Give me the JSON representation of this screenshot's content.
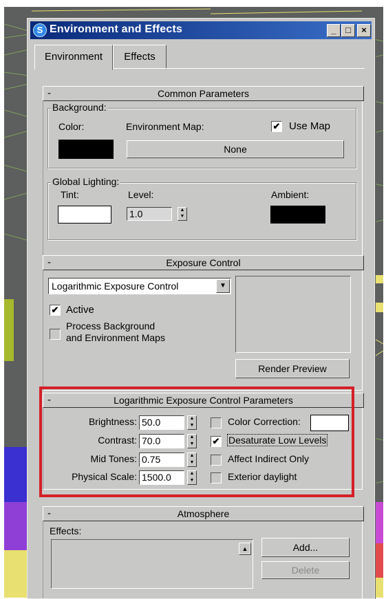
{
  "window": {
    "title": "Environment and Effects",
    "app_icon": "3ds-max-logo-icon",
    "buttons": {
      "minimize": "_",
      "maximize": "□",
      "close": "×"
    }
  },
  "tabs": [
    {
      "label": "Environment",
      "active": true
    },
    {
      "label": "Effects",
      "active": false
    }
  ],
  "common_parameters": {
    "title": "Common Parameters",
    "collapse": "-",
    "background": {
      "group_label": "Background:",
      "color_label": "Color:",
      "color_value": "#000000",
      "env_map_label": "Environment Map:",
      "use_map_label": "Use Map",
      "use_map_checked": true,
      "env_map_button": "None"
    },
    "global_lighting": {
      "group_label": "Global Lighting:",
      "tint_label": "Tint:",
      "tint_value": "#ffffff",
      "level_label": "Level:",
      "level_value": "1.0",
      "ambient_label": "Ambient:",
      "ambient_value": "#000000"
    }
  },
  "exposure_control": {
    "title": "Exposure Control",
    "collapse": "-",
    "selected": "Logarithmic Exposure Control",
    "active_label": "Active",
    "active_checked": true,
    "process_bg_label_1": "Process Background",
    "process_bg_label_2": "and Environment Maps",
    "process_bg_checked": false,
    "render_preview": "Render Preview"
  },
  "log_params": {
    "title": "Logarithmic Exposure Control Parameters",
    "collapse": "-",
    "brightness_label": "Brightness:",
    "brightness_value": "50.0",
    "contrast_label": "Contrast:",
    "contrast_value": "70.0",
    "midtones_label": "Mid Tones:",
    "midtones_value": "0.75",
    "physical_scale_label": "Physical Scale:",
    "physical_scale_value": "1500.0",
    "color_correction_label": "Color Correction:",
    "color_correction_checked": false,
    "color_correction_swatch": "#ffffff",
    "desaturate_label": "Desaturate Low Levels",
    "desaturate_checked": true,
    "affect_indirect_label": "Affect Indirect Only",
    "affect_indirect_checked": false,
    "exterior_daylight_label": "Exterior daylight",
    "exterior_daylight_checked": false,
    "highlight_color": "#d42028"
  },
  "atmosphere": {
    "title": "Atmosphere",
    "collapse": "-",
    "effects_label": "Effects:",
    "add_button": "Add...",
    "delete_button": "Delete"
  },
  "glyphs": {
    "check": "✔",
    "spin_up": "▲",
    "spin_down": "▼",
    "dd_arrow": "▼",
    "scroll_up": "▲"
  }
}
